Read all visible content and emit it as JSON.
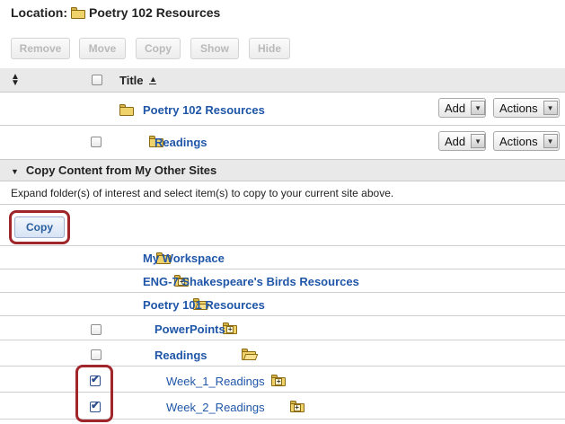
{
  "location": {
    "label": "Location:",
    "folder_name": "Poetry 102 Resources"
  },
  "toolbar": {
    "remove": "Remove",
    "move": "Move",
    "copy": "Copy",
    "show": "Show",
    "hide": "Hide"
  },
  "table_header": {
    "title": "Title"
  },
  "current_rows": [
    {
      "name": "Poetry 102 Resources",
      "add": "Add",
      "actions": "Actions"
    },
    {
      "name": "Readings",
      "add": "Add",
      "actions": "Actions"
    }
  ],
  "section": {
    "title": "Copy Content from My Other Sites",
    "instructions": "Expand folder(s) of interest and select item(s) to copy to your current site above.",
    "copy_button": "Copy"
  },
  "other_sites": [
    {
      "name": "My Workspace",
      "checked": false
    },
    {
      "name": "ENG-7 Shakespeare's Birds Resources",
      "checked": false
    },
    {
      "name": "Poetry 101 Resources",
      "checked": false
    },
    {
      "name": "PowerPoints",
      "checked": false
    },
    {
      "name": "Readings",
      "checked": false
    },
    {
      "name": "Week_1_Readings",
      "checked": true
    },
    {
      "name": "Week_2_Readings",
      "checked": true
    }
  ],
  "colors": {
    "link": "#1f56a8",
    "highlight": "#a1262c",
    "header_bg": "#e9e9e9"
  }
}
